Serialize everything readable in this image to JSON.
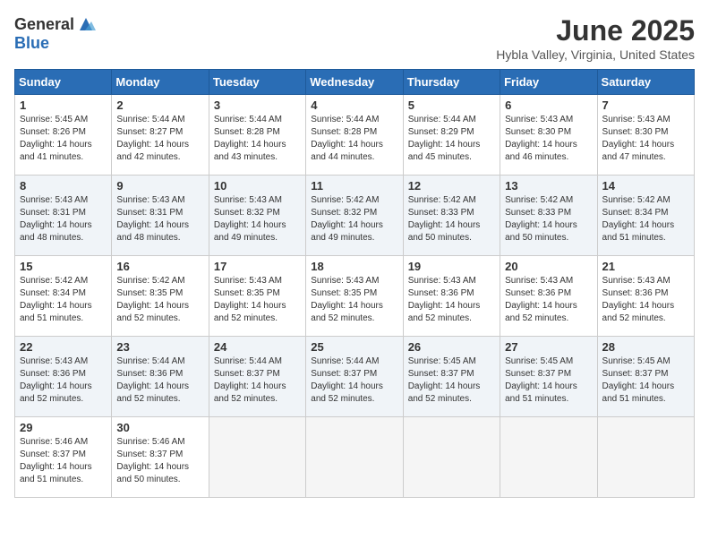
{
  "header": {
    "logo_general": "General",
    "logo_blue": "Blue",
    "title": "June 2025",
    "location": "Hybla Valley, Virginia, United States"
  },
  "calendar": {
    "days_of_week": [
      "Sunday",
      "Monday",
      "Tuesday",
      "Wednesday",
      "Thursday",
      "Friday",
      "Saturday"
    ],
    "weeks": [
      [
        null,
        {
          "date": "2",
          "sunrise": "Sunrise: 5:44 AM",
          "sunset": "Sunset: 8:27 PM",
          "daylight": "Daylight: 14 hours and 42 minutes."
        },
        {
          "date": "3",
          "sunrise": "Sunrise: 5:44 AM",
          "sunset": "Sunset: 8:28 PM",
          "daylight": "Daylight: 14 hours and 43 minutes."
        },
        {
          "date": "4",
          "sunrise": "Sunrise: 5:44 AM",
          "sunset": "Sunset: 8:28 PM",
          "daylight": "Daylight: 14 hours and 44 minutes."
        },
        {
          "date": "5",
          "sunrise": "Sunrise: 5:44 AM",
          "sunset": "Sunset: 8:29 PM",
          "daylight": "Daylight: 14 hours and 45 minutes."
        },
        {
          "date": "6",
          "sunrise": "Sunrise: 5:43 AM",
          "sunset": "Sunset: 8:30 PM",
          "daylight": "Daylight: 14 hours and 46 minutes."
        },
        {
          "date": "7",
          "sunrise": "Sunrise: 5:43 AM",
          "sunset": "Sunset: 8:30 PM",
          "daylight": "Daylight: 14 hours and 47 minutes."
        }
      ],
      [
        {
          "date": "1",
          "sunrise": "Sunrise: 5:45 AM",
          "sunset": "Sunset: 8:26 PM",
          "daylight": "Daylight: 14 hours and 41 minutes."
        },
        null,
        null,
        null,
        null,
        null,
        null
      ],
      [
        {
          "date": "8",
          "sunrise": "Sunrise: 5:43 AM",
          "sunset": "Sunset: 8:31 PM",
          "daylight": "Daylight: 14 hours and 48 minutes."
        },
        {
          "date": "9",
          "sunrise": "Sunrise: 5:43 AM",
          "sunset": "Sunset: 8:31 PM",
          "daylight": "Daylight: 14 hours and 48 minutes."
        },
        {
          "date": "10",
          "sunrise": "Sunrise: 5:43 AM",
          "sunset": "Sunset: 8:32 PM",
          "daylight": "Daylight: 14 hours and 49 minutes."
        },
        {
          "date": "11",
          "sunrise": "Sunrise: 5:42 AM",
          "sunset": "Sunset: 8:32 PM",
          "daylight": "Daylight: 14 hours and 49 minutes."
        },
        {
          "date": "12",
          "sunrise": "Sunrise: 5:42 AM",
          "sunset": "Sunset: 8:33 PM",
          "daylight": "Daylight: 14 hours and 50 minutes."
        },
        {
          "date": "13",
          "sunrise": "Sunrise: 5:42 AM",
          "sunset": "Sunset: 8:33 PM",
          "daylight": "Daylight: 14 hours and 50 minutes."
        },
        {
          "date": "14",
          "sunrise": "Sunrise: 5:42 AM",
          "sunset": "Sunset: 8:34 PM",
          "daylight": "Daylight: 14 hours and 51 minutes."
        }
      ],
      [
        {
          "date": "15",
          "sunrise": "Sunrise: 5:42 AM",
          "sunset": "Sunset: 8:34 PM",
          "daylight": "Daylight: 14 hours and 51 minutes."
        },
        {
          "date": "16",
          "sunrise": "Sunrise: 5:42 AM",
          "sunset": "Sunset: 8:35 PM",
          "daylight": "Daylight: 14 hours and 52 minutes."
        },
        {
          "date": "17",
          "sunrise": "Sunrise: 5:43 AM",
          "sunset": "Sunset: 8:35 PM",
          "daylight": "Daylight: 14 hours and 52 minutes."
        },
        {
          "date": "18",
          "sunrise": "Sunrise: 5:43 AM",
          "sunset": "Sunset: 8:35 PM",
          "daylight": "Daylight: 14 hours and 52 minutes."
        },
        {
          "date": "19",
          "sunrise": "Sunrise: 5:43 AM",
          "sunset": "Sunset: 8:36 PM",
          "daylight": "Daylight: 14 hours and 52 minutes."
        },
        {
          "date": "20",
          "sunrise": "Sunrise: 5:43 AM",
          "sunset": "Sunset: 8:36 PM",
          "daylight": "Daylight: 14 hours and 52 minutes."
        },
        {
          "date": "21",
          "sunrise": "Sunrise: 5:43 AM",
          "sunset": "Sunset: 8:36 PM",
          "daylight": "Daylight: 14 hours and 52 minutes."
        }
      ],
      [
        {
          "date": "22",
          "sunrise": "Sunrise: 5:43 AM",
          "sunset": "Sunset: 8:36 PM",
          "daylight": "Daylight: 14 hours and 52 minutes."
        },
        {
          "date": "23",
          "sunrise": "Sunrise: 5:44 AM",
          "sunset": "Sunset: 8:36 PM",
          "daylight": "Daylight: 14 hours and 52 minutes."
        },
        {
          "date": "24",
          "sunrise": "Sunrise: 5:44 AM",
          "sunset": "Sunset: 8:37 PM",
          "daylight": "Daylight: 14 hours and 52 minutes."
        },
        {
          "date": "25",
          "sunrise": "Sunrise: 5:44 AM",
          "sunset": "Sunset: 8:37 PM",
          "daylight": "Daylight: 14 hours and 52 minutes."
        },
        {
          "date": "26",
          "sunrise": "Sunrise: 5:45 AM",
          "sunset": "Sunset: 8:37 PM",
          "daylight": "Daylight: 14 hours and 52 minutes."
        },
        {
          "date": "27",
          "sunrise": "Sunrise: 5:45 AM",
          "sunset": "Sunset: 8:37 PM",
          "daylight": "Daylight: 14 hours and 51 minutes."
        },
        {
          "date": "28",
          "sunrise": "Sunrise: 5:45 AM",
          "sunset": "Sunset: 8:37 PM",
          "daylight": "Daylight: 14 hours and 51 minutes."
        }
      ],
      [
        {
          "date": "29",
          "sunrise": "Sunrise: 5:46 AM",
          "sunset": "Sunset: 8:37 PM",
          "daylight": "Daylight: 14 hours and 51 minutes."
        },
        {
          "date": "30",
          "sunrise": "Sunrise: 5:46 AM",
          "sunset": "Sunset: 8:37 PM",
          "daylight": "Daylight: 14 hours and 50 minutes."
        },
        null,
        null,
        null,
        null,
        null
      ]
    ]
  }
}
